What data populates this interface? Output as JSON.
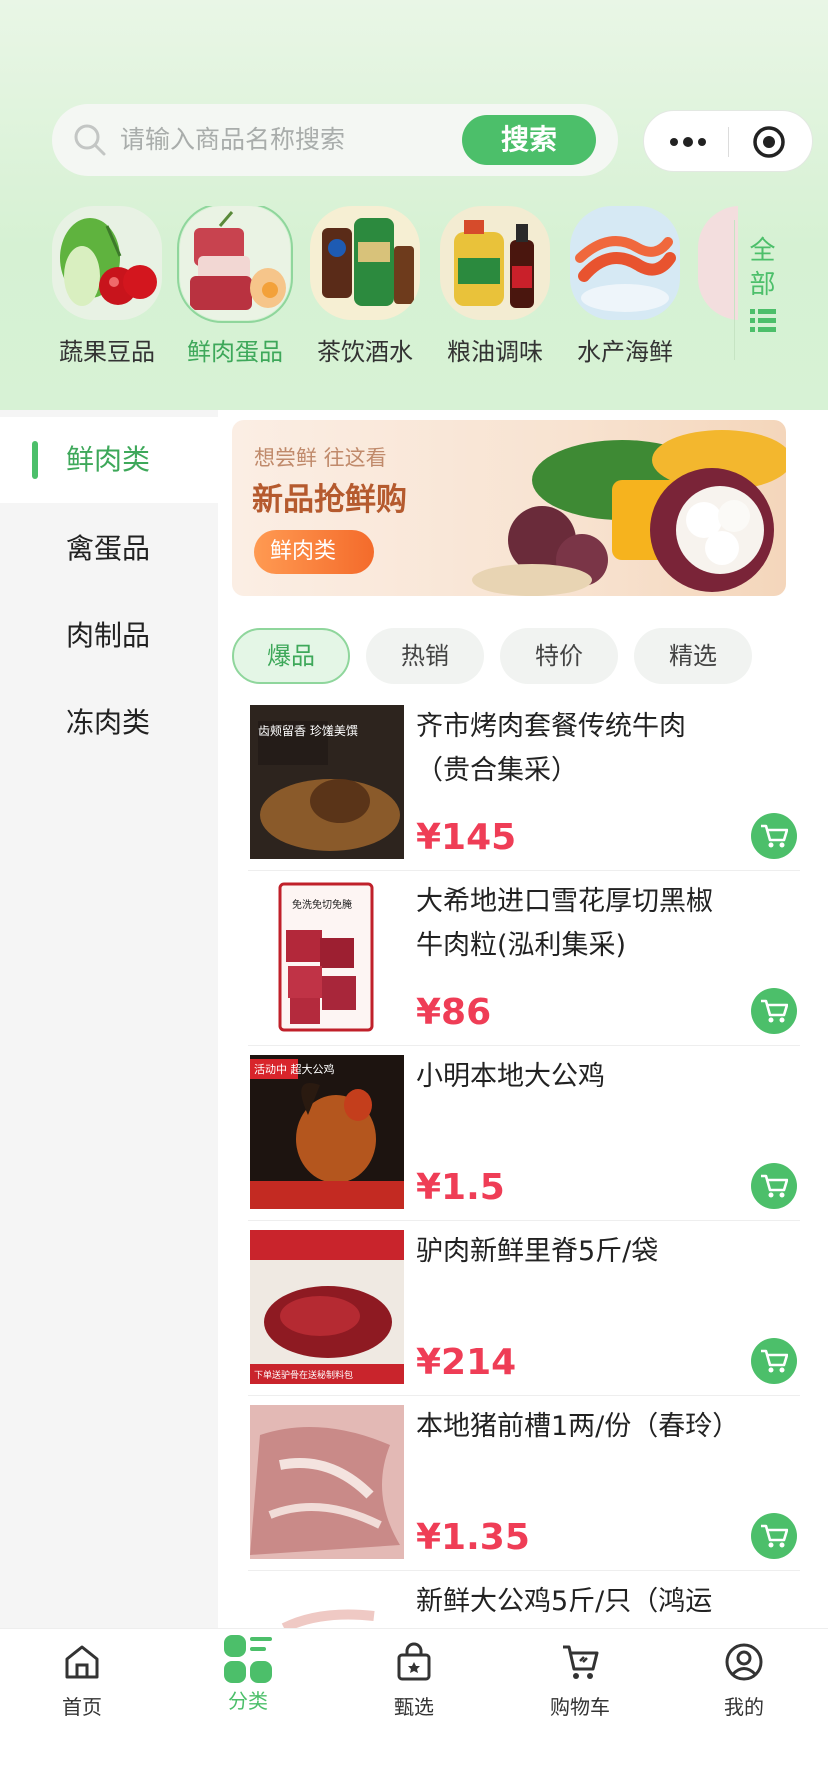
{
  "search": {
    "placeholder": "请输入商品名称搜索",
    "button": "搜索"
  },
  "categories": [
    {
      "label": "蔬果豆品",
      "active": false
    },
    {
      "label": "鲜肉蛋品",
      "active": true
    },
    {
      "label": "茶饮酒水",
      "active": false
    },
    {
      "label": "粮油调味",
      "active": false
    },
    {
      "label": "水产海鲜",
      "active": false
    }
  ],
  "category_all": {
    "line1": "全",
    "line2": "部"
  },
  "sidebar": {
    "items": [
      {
        "label": "鲜肉类",
        "active": true
      },
      {
        "label": "禽蛋品",
        "active": false
      },
      {
        "label": "肉制品",
        "active": false
      },
      {
        "label": "冻肉类",
        "active": false
      }
    ]
  },
  "banner": {
    "subtitle": "想尝鲜 往这看",
    "title": "新品抢鲜购",
    "tag": "鲜肉类"
  },
  "filters": [
    {
      "label": "爆品",
      "active": true
    },
    {
      "label": "热销",
      "active": false
    },
    {
      "label": "特价",
      "active": false
    },
    {
      "label": "精选",
      "active": false
    }
  ],
  "products": [
    {
      "name": "齐市烤肉套餐传统牛肉（贵合集采）",
      "price": "¥145",
      "thumb_text": "齿颊留香 珍馐美馔"
    },
    {
      "name": "大希地进口雪花厚切黑椒牛肉粒(泓利集采)",
      "price": "¥86",
      "thumb_text": "免洗免切免腌"
    },
    {
      "name": "小明本地大公鸡",
      "price": "¥1.5",
      "thumb_text": "活动中 超大公鸡"
    },
    {
      "name": "驴肉新鲜里脊5斤/袋",
      "price": "¥214",
      "thumb_text": "下单送驴骨在送秘制料包"
    },
    {
      "name": "本地猪前槽1两/份（春玲）",
      "price": "¥1.35",
      "thumb_text": ""
    },
    {
      "name": "新鲜大公鸡5斤/只（鸿运",
      "price": "",
      "thumb_text": ""
    }
  ],
  "tabbar": [
    {
      "label": "首页",
      "icon": "home-icon",
      "active": false
    },
    {
      "label": "分类",
      "icon": "category-icon",
      "active": true
    },
    {
      "label": "甄选",
      "icon": "select-bag-icon",
      "active": false
    },
    {
      "label": "购物车",
      "icon": "cart-icon",
      "active": false
    },
    {
      "label": "我的",
      "icon": "user-icon",
      "active": false
    }
  ],
  "colors": {
    "accent": "#4cbf6a",
    "price": "#ef3d56",
    "header_bg": "#d7f2d5"
  }
}
